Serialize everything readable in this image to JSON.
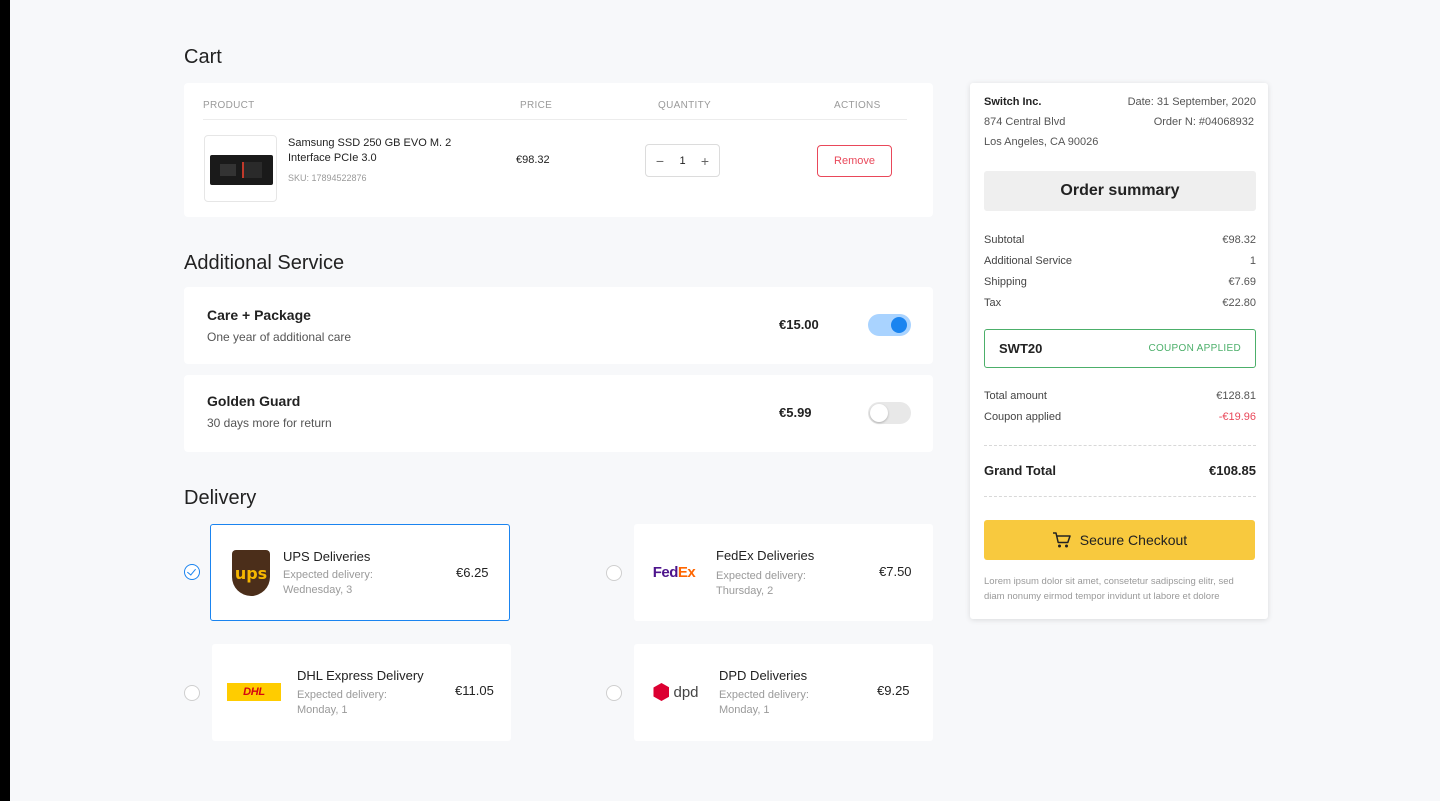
{
  "cart": {
    "title": "Cart",
    "headers": {
      "product": "PRODUCT",
      "price": "PRICE",
      "quantity": "QUANTITY",
      "actions": "ACTIONS"
    },
    "item": {
      "name": "Samsung SSD 250 GB EVO M. 2 Interface PCIe 3.0",
      "sku": "SKU: 17894522876",
      "price": "€98.32",
      "quantity": "1",
      "minus": "−",
      "plus": "+",
      "remove_label": "Remove"
    }
  },
  "additional_service": {
    "title": "Additional Service",
    "items": [
      {
        "name": "Care + Package",
        "desc": "One year of additional care",
        "price": "€15.00",
        "enabled": true
      },
      {
        "name": "Golden Guard",
        "desc": "30 days more for return",
        "price": "€5.99",
        "enabled": false
      }
    ]
  },
  "delivery": {
    "title": "Delivery",
    "options": [
      {
        "name": "UPS Deliveries",
        "exp_label": "Expected delivery:",
        "exp_day": "Wednesday, 3",
        "price": "€6.25",
        "selected": true,
        "logo": "ups"
      },
      {
        "name": "FedEx Deliveries",
        "exp_label": "Expected delivery:",
        "exp_day": "Thursday, 2",
        "price": "€7.50",
        "selected": false,
        "logo": "fedex"
      },
      {
        "name": "DHL Express Delivery",
        "exp_label": "Expected delivery:",
        "exp_day": "Monday, 1",
        "price": "€11.05",
        "selected": false,
        "logo": "dhl"
      },
      {
        "name": "DPD Deliveries",
        "exp_label": "Expected delivery:",
        "exp_day": "Monday, 1",
        "price": "€9.25",
        "selected": false,
        "logo": "dpd"
      }
    ],
    "logo_text": {
      "ups": "ups",
      "fedex_fe": "Fed",
      "fedex_ex": "Ex",
      "dhl": "DHL",
      "dpd": "dpd"
    }
  },
  "summary": {
    "company": "Switch Inc.",
    "address1": "874 Central Blvd",
    "address2": "Los Angeles, CA 90026",
    "date": "Date: 31 September, 2020",
    "order_no": "Order N: #04068932",
    "title": "Order summary",
    "rows": [
      {
        "label": "Subtotal",
        "value": "€98.32"
      },
      {
        "label": "Additional Service",
        "value": "1"
      },
      {
        "label": "Shipping",
        "value": "€7.69"
      },
      {
        "label": "Tax",
        "value": "€22.80"
      }
    ],
    "coupon": {
      "code": "SWT20",
      "status": "COUPON APPLIED"
    },
    "total_amount_label": "Total amount",
    "total_amount": "€128.81",
    "coupon_applied_label": "Coupon applied",
    "coupon_applied": "-€19.96",
    "grand_total_label": "Grand Total",
    "grand_total": "€108.85",
    "checkout_label": "Secure Checkout",
    "note": "Lorem ipsum dolor sit amet, consetetur sadipscing elitr, sed diam nonumy eirmod tempor invidunt ut labore et dolore"
  },
  "colors": {
    "accent": "#1a84f0",
    "danger": "#e9485a",
    "success": "#4caf6a",
    "checkout": "#f8c93e"
  }
}
